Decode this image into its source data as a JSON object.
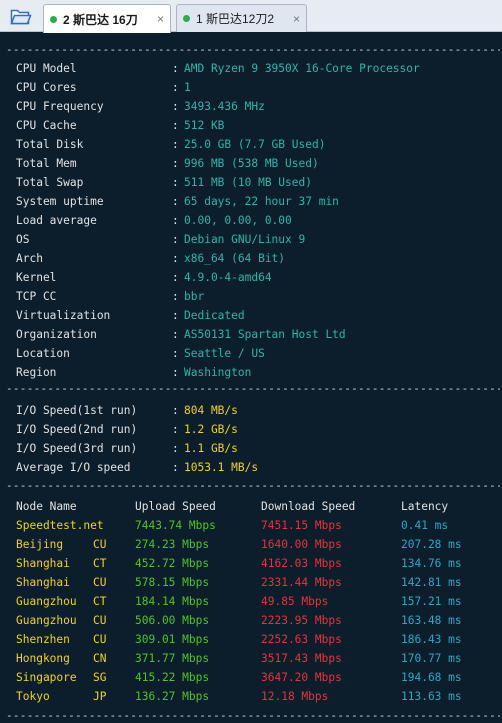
{
  "tabs": [
    {
      "label": "2 斯巴达 16刀",
      "close": "×",
      "active": true
    },
    {
      "label": "1 斯巴达12刀2",
      "close": "×",
      "active": false
    }
  ],
  "separator": "---------------------------------------------------------------------------",
  "sysinfo": [
    {
      "key": "CPU Model",
      "value": "AMD Ryzen 9 3950X 16-Core Processor"
    },
    {
      "key": "CPU Cores",
      "value": "1"
    },
    {
      "key": "CPU Frequency",
      "value": "3493.436 MHz"
    },
    {
      "key": "CPU Cache",
      "value": "512 KB"
    },
    {
      "key": "Total Disk",
      "value": "25.0 GB (7.7 GB Used)"
    },
    {
      "key": "Total Mem",
      "value": "996 MB (538 MB Used)"
    },
    {
      "key": "Total Swap",
      "value": "511 MB (10 MB Used)"
    },
    {
      "key": "System uptime",
      "value": "65 days, 22 hour 37 min"
    },
    {
      "key": "Load average",
      "value": "0.00, 0.00, 0.00"
    },
    {
      "key": "OS",
      "value": "Debian GNU/Linux 9"
    },
    {
      "key": "Arch",
      "value": "x86_64 (64 Bit)"
    },
    {
      "key": "Kernel",
      "value": "4.9.0-4-amd64"
    },
    {
      "key": "TCP CC",
      "value": "bbr"
    },
    {
      "key": "Virtualization",
      "value": "Dedicated"
    },
    {
      "key": "Organization",
      "value": "AS50131 Spartan Host Ltd"
    },
    {
      "key": "Location",
      "value": "Seattle / US"
    },
    {
      "key": "Region",
      "value": "Washington"
    }
  ],
  "io": [
    {
      "key": "I/O Speed(1st run)",
      "value": "804 MB/s"
    },
    {
      "key": "I/O Speed(2nd run)",
      "value": "1.2 GB/s"
    },
    {
      "key": "I/O Speed(3rd run)",
      "value": "1.1 GB/s"
    },
    {
      "key": "Average I/O speed",
      "value": "1053.1 MB/s"
    }
  ],
  "speed_headers": {
    "node": "Node Name",
    "upload": "Upload Speed",
    "download": "Download Speed",
    "latency": "Latency"
  },
  "speed": [
    {
      "node": "Speedtest.net",
      "code": "",
      "upload": "7443.74 Mbps",
      "download": "7451.15 Mbps",
      "latency": "0.41 ms"
    },
    {
      "node": "Beijing",
      "code": "CU",
      "upload": "274.23 Mbps",
      "download": "1640.00 Mbps",
      "latency": "207.28 ms"
    },
    {
      "node": "Shanghai",
      "code": "CT",
      "upload": "452.72 Mbps",
      "download": "4162.03 Mbps",
      "latency": "134.76 ms"
    },
    {
      "node": "Shanghai",
      "code": "CU",
      "upload": "578.15 Mbps",
      "download": "2331.44 Mbps",
      "latency": "142.81 ms"
    },
    {
      "node": "Guangzhou",
      "code": "CT",
      "upload": "184.14 Mbps",
      "download": "49.85 Mbps",
      "latency": "157.21 ms"
    },
    {
      "node": "Guangzhou",
      "code": "CU",
      "upload": "506.00 Mbps",
      "download": "2223.95 Mbps",
      "latency": "163.48 ms"
    },
    {
      "node": "Shenzhen",
      "code": "CU",
      "upload": "309.01 Mbps",
      "download": "2252.63 Mbps",
      "latency": "186.43 ms"
    },
    {
      "node": "Hongkong",
      "code": "CN",
      "upload": "371.77 Mbps",
      "download": "3517.43 Mbps",
      "latency": "170.77 ms"
    },
    {
      "node": "Singapore",
      "code": "SG",
      "upload": "415.22 Mbps",
      "download": "3647.20 Mbps",
      "latency": "194.68 ms"
    },
    {
      "node": "Tokyo",
      "code": "JP",
      "upload": "136.27 Mbps",
      "download": "12.18 Mbps",
      "latency": "113.63 ms"
    }
  ],
  "colors": {
    "background": "#0c1e2c",
    "teal": "#29b7a9",
    "yellow": "#f2d31a",
    "green": "#4fc426",
    "red": "#e8323a",
    "cyan": "#2ba8c5"
  }
}
